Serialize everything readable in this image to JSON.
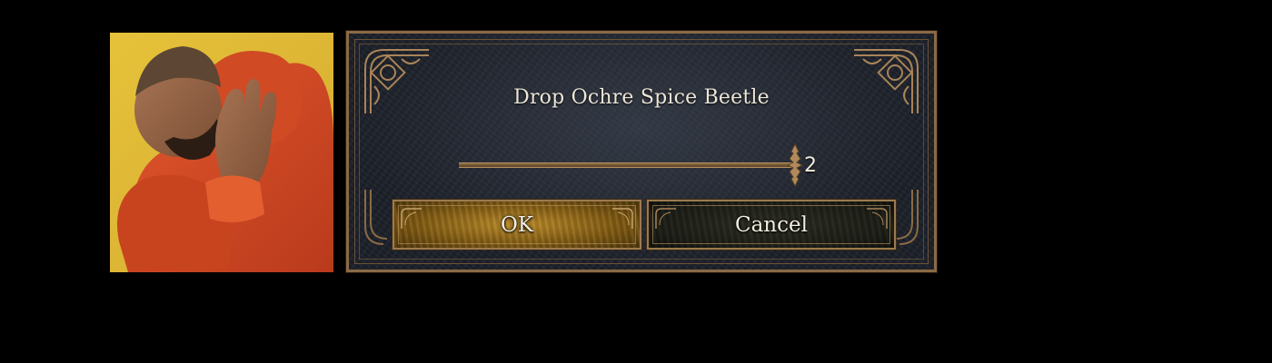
{
  "dialog": {
    "title": "Drop Ochre Spice Beetle",
    "quantity": {
      "value": "2",
      "min": 1,
      "max": 2,
      "fraction": 1.0
    },
    "buttons": {
      "ok_label": "OK",
      "cancel_label": "Cancel"
    }
  },
  "meme_panel": {
    "description_icon": "person-refusing-gesture-image"
  },
  "colors": {
    "background": "#000000",
    "dialog_bg": "#1c2029",
    "gold_trim": "#9c7a4e",
    "ok_button": "#b98a2a",
    "cancel_button": "#1a1c15",
    "text": "#ece6d8",
    "photo_bg": "#e6c23a"
  }
}
